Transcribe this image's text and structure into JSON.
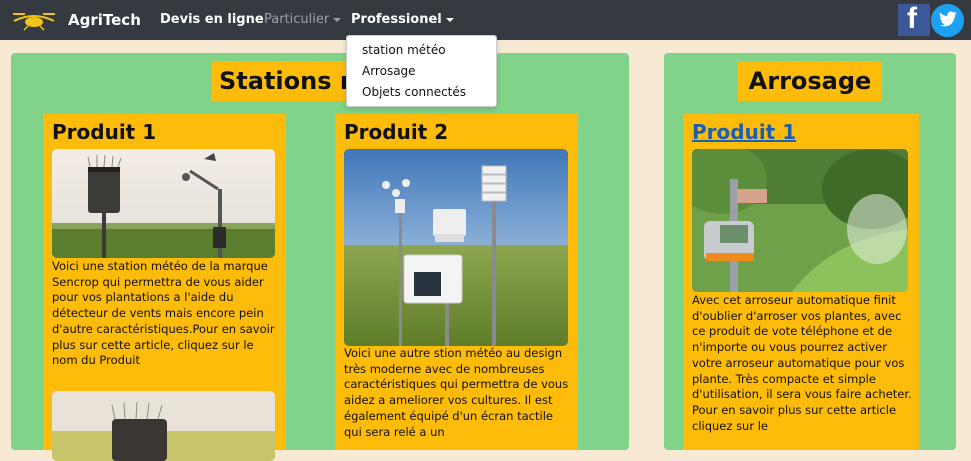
{
  "navbar": {
    "brand": "AgriTech",
    "links": [
      "Devis en ligne",
      "Particulier",
      "Professionel"
    ],
    "social": [
      "facebook-icon",
      "twitter-icon"
    ]
  },
  "dropdown": {
    "items": [
      "station météo",
      "Arrosage",
      "Objets connectés"
    ]
  },
  "stations": {
    "title": "Stations météo",
    "cards": [
      {
        "title": "Produit 1",
        "text": "Voici une station météo de la marque Sencrop qui permettra de vous aider pour vos plantations a l'aide du détecteur de vents mais encore pein d'autre caractéristiques.Pour en savoir plus sur cette article, cliquez sur le nom du Produit"
      },
      {
        "title": "Produit 2",
        "text": "Voici une autre stion météo au design très moderne avec de nombreuses caractéristiques qui permettra de vous aidez a ameliorer vos cultures. Il est également équipé d'un écran tactile qui sera relé a un"
      }
    ]
  },
  "arrosage": {
    "title": "Arrosage",
    "cards": [
      {
        "title": "Produit 1",
        "text": "Avec cet arroseur automatique finit d'oublier d'arroser vos plantes, avec ce produit de vote téléphone et de n'importe ou vous pourrez activer votre arroseur automatique pour vos plante. Très compacte et simple d'utilisation, il sera vous faire acheter. Pour en savoir plus sur cette article cliquez sur le"
      }
    ]
  },
  "colors": {
    "navbar": "#343a40",
    "panel": "#80d389",
    "card": "#fdbb0a",
    "background": "#f7e9d3",
    "link": "#1d5fae"
  }
}
